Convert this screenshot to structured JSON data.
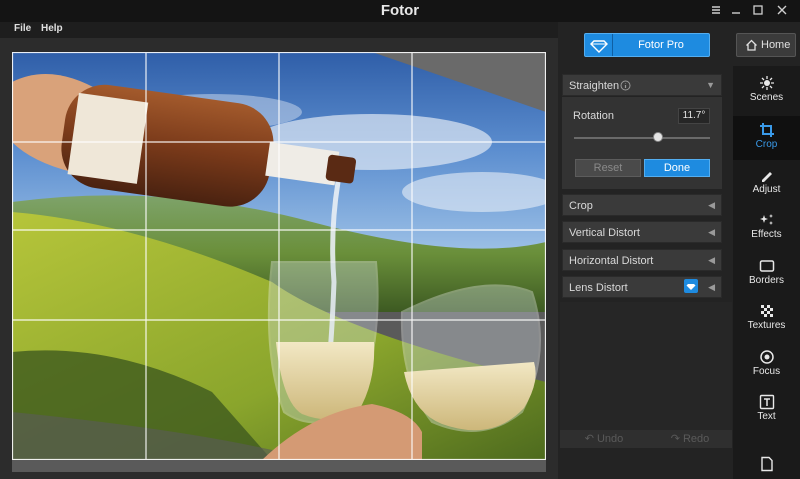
{
  "window": {
    "title": "Fotor"
  },
  "menu": {
    "items": [
      "File",
      "Help"
    ]
  },
  "header": {
    "pro_label": "Fotor Pro",
    "home_label": "Home"
  },
  "straighten": {
    "title": "Straighten",
    "rotation_label": "Rotation",
    "rotation_value": "11.7°",
    "slider_fraction": 0.62,
    "reset_label": "Reset",
    "done_label": "Done"
  },
  "sections": [
    "Crop",
    "Vertical Distort",
    "Horizontal Distort",
    "Lens Distort"
  ],
  "history": {
    "undo_label": "Undo",
    "redo_label": "Redo"
  },
  "tools": [
    {
      "label": "Scenes",
      "icon": "scenes-icon"
    },
    {
      "label": "Crop",
      "icon": "crop-icon",
      "active": true
    },
    {
      "label": "Adjust",
      "icon": "adjust-icon"
    },
    {
      "label": "Effects",
      "icon": "effects-icon"
    },
    {
      "label": "Borders",
      "icon": "borders-icon"
    },
    {
      "label": "Textures",
      "icon": "textures-icon"
    },
    {
      "label": "Focus",
      "icon": "focus-icon"
    },
    {
      "label": "Text",
      "icon": "text-icon"
    }
  ],
  "colors": {
    "accent": "#1e8be0",
    "active_tool": "#3a9ae8"
  }
}
